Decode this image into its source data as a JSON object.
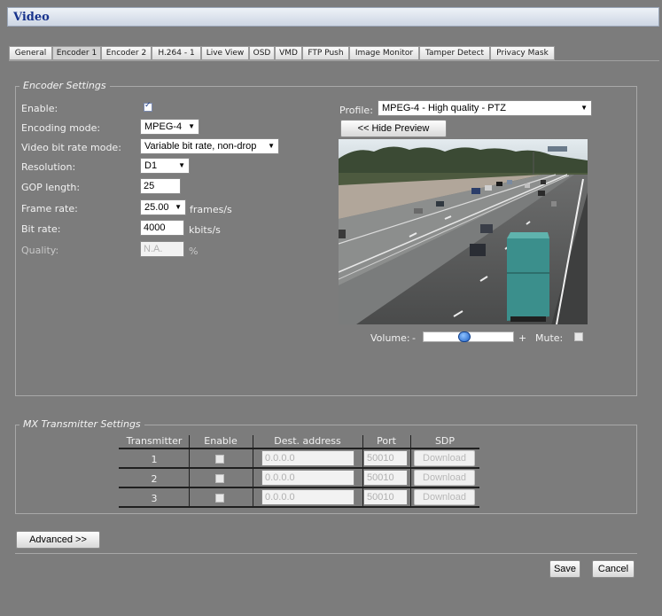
{
  "page_title": "Video",
  "tabs": [
    "General",
    "Encoder 1",
    "Encoder 2",
    "H.264 - 1",
    "Live View",
    "OSD",
    "VMD",
    "FTP Push",
    "Image Monitor",
    "Tamper Detect",
    "Privacy Mask"
  ],
  "active_tab": "Encoder 1",
  "encoder_settings": {
    "legend": "Encoder Settings",
    "enable_label": "Enable:",
    "enable_checked": true,
    "encoding_mode_label": "Encoding mode:",
    "encoding_mode_value": "MPEG-4",
    "bitrate_mode_label": "Video bit rate mode:",
    "bitrate_mode_value": "Variable bit rate, non-drop",
    "resolution_label": "Resolution:",
    "resolution_value": "D1",
    "gop_label": "GOP length:",
    "gop_value": "25",
    "frame_rate_label": "Frame rate:",
    "frame_rate_value": "25.00",
    "frame_rate_unit": "frames/s",
    "bit_rate_label": "Bit rate:",
    "bit_rate_value": "4000",
    "bit_rate_unit": "kbits/s",
    "quality_label": "Quality:",
    "quality_value": "N.A.",
    "quality_unit": "%",
    "profile_label": "Profile:",
    "profile_value": "MPEG-4 - High quality - PTZ",
    "hide_preview_label": "<< Hide Preview",
    "volume_label": "Volume:",
    "volume_minus": "-",
    "volume_plus": "+",
    "volume_level": 0.45,
    "mute_label": "Mute:",
    "mute_checked": false
  },
  "mx_settings": {
    "legend": "MX Transmitter Settings",
    "headers": [
      "Transmitter",
      "Enable",
      "Dest. address",
      "Port",
      "SDP"
    ],
    "rows": [
      {
        "transmitter": "1",
        "enabled": false,
        "dest": "0.0.0.0",
        "port": "50010",
        "sdp": "Download"
      },
      {
        "transmitter": "2",
        "enabled": false,
        "dest": "0.0.0.0",
        "port": "50010",
        "sdp": "Download"
      },
      {
        "transmitter": "3",
        "enabled": false,
        "dest": "0.0.0.0",
        "port": "50010",
        "sdp": "Download"
      }
    ]
  },
  "buttons": {
    "advanced": "Advanced >>",
    "save": "Save",
    "cancel": "Cancel"
  },
  "colors": {
    "background": "#7c7c7c",
    "title_text": "#17328c",
    "truck": "#3b8f8c"
  }
}
